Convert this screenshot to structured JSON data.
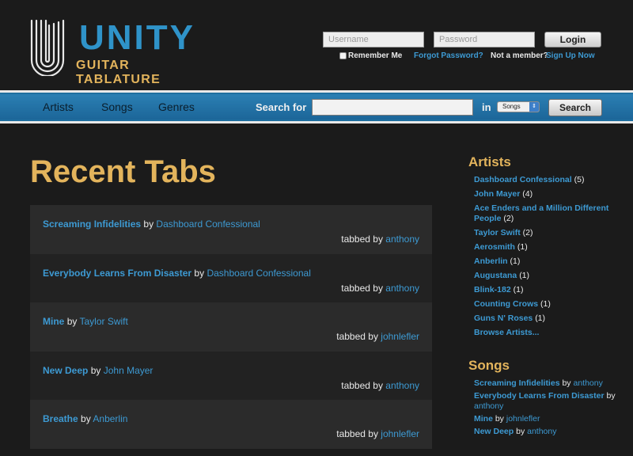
{
  "brand": {
    "name": "UNITY",
    "tagline": "GUITAR TABLATURE"
  },
  "login": {
    "username_placeholder": "Username",
    "password_placeholder": "Password",
    "login_label": "Login",
    "remember_label": "Remember Me",
    "forgot_label": "Forgot Password?",
    "member_question": "Not a member?",
    "signup_label": "Sign Up Now"
  },
  "nav": {
    "items": [
      "Artists",
      "Songs",
      "Genres"
    ],
    "search_label": "Search for",
    "in_label": "in",
    "search_scope": "Songs",
    "search_button": "Search"
  },
  "main": {
    "title": "Recent Tabs",
    "tabbed_by_label": "tabbed by",
    "by_label": "by",
    "tabs": [
      {
        "song": "Screaming Infidelities",
        "artist": "Dashboard Confessional",
        "user": "anthony"
      },
      {
        "song": "Everybody Learns From Disaster",
        "artist": "Dashboard Confessional",
        "user": "anthony"
      },
      {
        "song": "Mine",
        "artist": "Taylor Swift",
        "user": "johnlefler"
      },
      {
        "song": "New Deep",
        "artist": "John Mayer",
        "user": "anthony"
      },
      {
        "song": "Breathe",
        "artist": "Anberlin",
        "user": "johnlefler"
      }
    ]
  },
  "sidebar": {
    "artists_heading": "Artists",
    "artists": [
      {
        "name": "Dashboard Confessional",
        "count": "(5)"
      },
      {
        "name": "John Mayer",
        "count": "(4)"
      },
      {
        "name": "Ace Enders and a Million Different People",
        "count": "(2)"
      },
      {
        "name": "Taylor Swift",
        "count": "(2)"
      },
      {
        "name": "Aerosmith",
        "count": "(1)"
      },
      {
        "name": "Anberlin",
        "count": "(1)"
      },
      {
        "name": "Augustana",
        "count": "(1)"
      },
      {
        "name": "Blink-182",
        "count": "(1)"
      },
      {
        "name": "Counting Crows",
        "count": "(1)"
      },
      {
        "name": "Guns N' Roses",
        "count": "(1)"
      }
    ],
    "browse_label": "Browse Artists...",
    "songs_heading": "Songs",
    "songs": [
      {
        "name": "Screaming Infidelities",
        "user": "anthony"
      },
      {
        "name": "Everybody Learns From Disaster",
        "user": "anthony"
      },
      {
        "name": "Mine",
        "user": "johnlefler"
      },
      {
        "name": "New Deep",
        "user": "anthony"
      }
    ]
  },
  "colors": {
    "accent_blue": "#2f93c9",
    "link_blue": "#3d9ad3",
    "heading_gold": "#e3b45c",
    "background": "#1b1b1b"
  }
}
